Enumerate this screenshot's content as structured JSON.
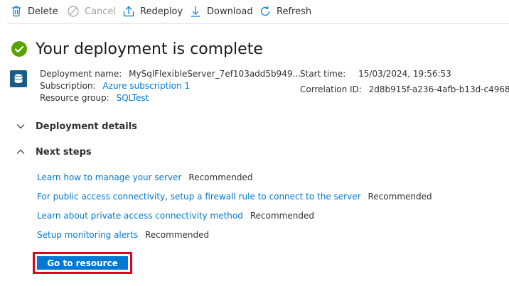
{
  "toolbar": {
    "delete_label": "Delete",
    "cancel_label": "Cancel",
    "redeploy_label": "Redeploy",
    "download_label": "Download",
    "refresh_label": "Refresh"
  },
  "title": "Your deployment is complete",
  "summary": {
    "deployment_name_label": "Deployment name:",
    "deployment_name_value": "MySqlFlexibleServer_7ef103add5b949...",
    "subscription_label": "Subscription:",
    "subscription_value": "Azure subscription 1",
    "resource_group_label": "Resource group:",
    "resource_group_value": "SQLTest",
    "start_time_label": "Start time:",
    "start_time_value": "15/03/2024, 19:56:53",
    "correlation_id_label": "Correlation ID:",
    "correlation_id_value": "2d8b915f-a236-4afb-b13d-c4968"
  },
  "sections": {
    "deployment_details": "Deployment details",
    "next_steps": "Next steps"
  },
  "next_steps": [
    {
      "link": "Learn how to manage your server",
      "tag": "Recommended"
    },
    {
      "link": "For public access connectivity, setup a firewall rule to connect to the server",
      "tag": "Recommended"
    },
    {
      "link": "Learn about private access connectivity method",
      "tag": "Recommended"
    },
    {
      "link": "Setup monitoring alerts",
      "tag": "Recommended"
    }
  ],
  "go_to_resource_label": "Go to resource",
  "colors": {
    "accent": "#0078d4",
    "success": "#57a300",
    "highlight_border": "#e4001b"
  }
}
